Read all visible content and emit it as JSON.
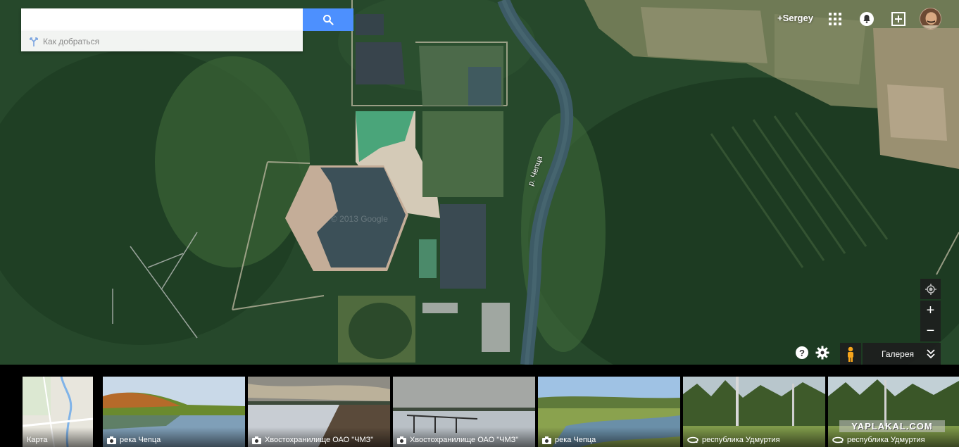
{
  "search": {
    "value": "",
    "placeholder": "",
    "directions_label": "Как добраться"
  },
  "header": {
    "user_link": "+Sergey",
    "icons": [
      "apps-grid-icon",
      "notifications-bell-icon",
      "share-plus-icon"
    ]
  },
  "map": {
    "watermark": "© 2013 Google",
    "river_label": "р. Чепца",
    "colors": {
      "forest": "#23452a",
      "water": "#3c5058",
      "river": "#3d5b66",
      "field": "#8a8c6a",
      "sand": "#cfc5b2",
      "lagoon": "#4aa57a"
    }
  },
  "controls": {
    "locate": "target-icon",
    "zoom_in": "+",
    "zoom_out": "−",
    "help": "?",
    "settings": "gear-icon",
    "pegman": "pegman-icon",
    "gallery_label": "Галерея",
    "gallery_chevron": "double-chevron-down-icon"
  },
  "gallery": {
    "map_thumb_label": "Карта",
    "photos": [
      {
        "caption": "река Чепца",
        "icon": "camera-icon"
      },
      {
        "caption": "Хвостохранилище ОАО \"ЧМЗ\"",
        "icon": "camera-icon"
      },
      {
        "caption": "Хвостохранилище ОАО \"ЧМЗ\"",
        "icon": "camera-icon"
      },
      {
        "caption": "река Чепца",
        "icon": "camera-icon"
      },
      {
        "caption": "республика Удмуртия",
        "icon": "panorama-icon"
      },
      {
        "caption": "республика Удмуртия",
        "icon": "panorama-icon"
      }
    ],
    "site_watermark": "YAPLAKAL.COM"
  },
  "colors": {
    "accent_blue": "#4d90fe",
    "control_bg": "#1e1e1e",
    "pegman_orange": "#f7a51c"
  }
}
